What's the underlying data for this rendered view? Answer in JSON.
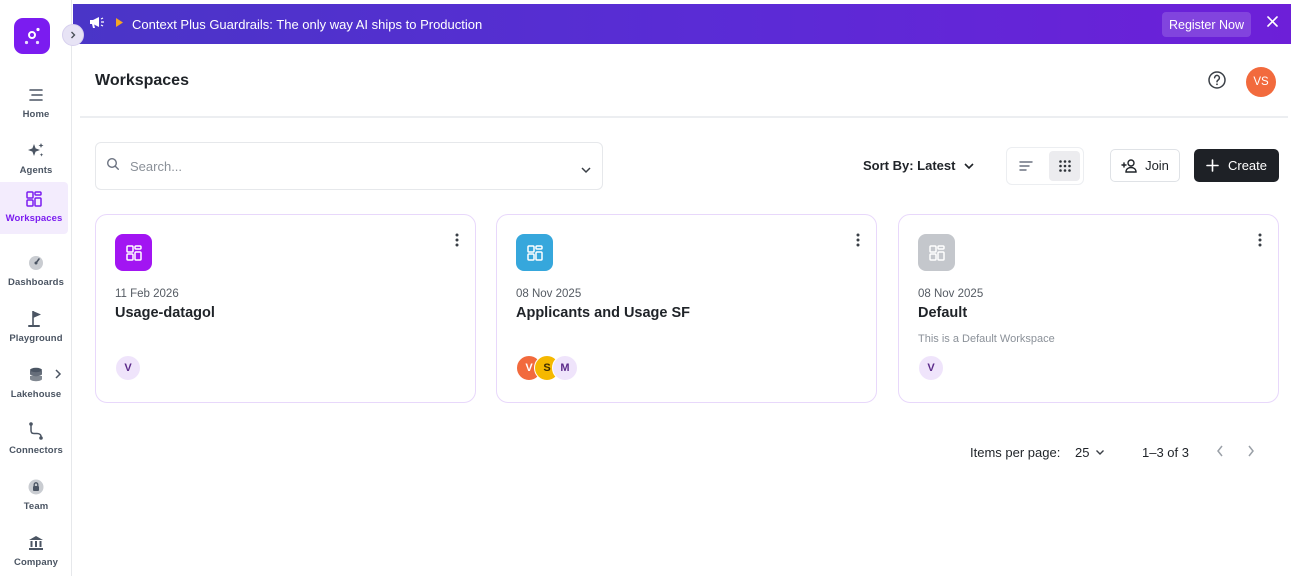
{
  "banner": {
    "text": "Context Plus Guardrails: The only way AI ships to Production",
    "register_label": "Register Now"
  },
  "sidebar": {
    "items": [
      {
        "label": "Home",
        "icon": "menu-icon"
      },
      {
        "label": "Agents",
        "icon": "sparkles-icon"
      },
      {
        "label": "Workspaces",
        "icon": "workspaces-icon",
        "active": true
      },
      {
        "label": "Dashboards",
        "icon": "gauge-icon"
      },
      {
        "label": "Playground",
        "icon": "flag-icon"
      },
      {
        "label": "Lakehouse",
        "icon": "database-icon"
      },
      {
        "label": "Connectors",
        "icon": "connector-icon"
      },
      {
        "label": "Team",
        "icon": "lock-icon"
      },
      {
        "label": "Company",
        "icon": "bank-icon"
      }
    ]
  },
  "header": {
    "title": "Workspaces",
    "avatar_initials": "VS"
  },
  "toolbar": {
    "search_placeholder": "Search...",
    "sort_label": "Sort By: Latest",
    "join_label": "Join",
    "create_label": "Create"
  },
  "cards": [
    {
      "date": "11 Feb 2026",
      "title": "Usage-datagol",
      "description": "",
      "icon_color": "#a215f2",
      "members": [
        {
          "initial": "V",
          "bg": "#efe4fb",
          "fg": "#5b2a8a"
        }
      ]
    },
    {
      "date": "08 Nov 2025",
      "title": "Applicants and Usage SF",
      "description": "",
      "icon_color": "#36a7dc",
      "members": [
        {
          "initial": "V",
          "bg": "#f26a3d",
          "fg": "#ffffff"
        },
        {
          "initial": "S",
          "bg": "#f5b800",
          "fg": "#3b2a00"
        },
        {
          "initial": "M",
          "bg": "#efe4fb",
          "fg": "#5b2a8a"
        }
      ]
    },
    {
      "date": "08 Nov 2025",
      "title": "Default",
      "description": "This is a Default Workspace",
      "icon_color": "#c4c7cc",
      "members": [
        {
          "initial": "V",
          "bg": "#efe4fb",
          "fg": "#5b2a8a"
        }
      ]
    }
  ],
  "pagination": {
    "items_per_page_label": "Items per page:",
    "page_size": "25",
    "range": "1–3 of 3"
  },
  "colors": {
    "accent": "#7b1cf0",
    "create_bg": "#1e2126",
    "card_border": "#e8d8fb"
  }
}
